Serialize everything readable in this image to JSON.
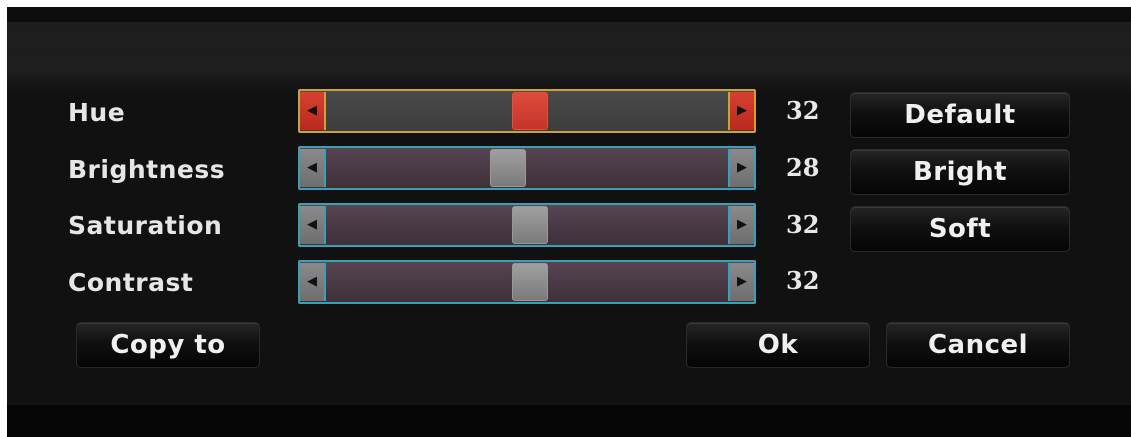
{
  "window": {
    "title": ""
  },
  "rows": [
    {
      "label": "Hue",
      "value": "32",
      "level": 0.5,
      "dec": "◀",
      "inc": "▶"
    },
    {
      "label": "Brightness",
      "value": "28",
      "level": 0.44,
      "dec": "◀",
      "inc": "▶"
    },
    {
      "label": "Saturation",
      "value": "32",
      "level": 0.5,
      "dec": "◀",
      "inc": "▶"
    },
    {
      "label": "Contrast",
      "value": "32",
      "level": 0.5,
      "dec": "◀",
      "inc": "▶"
    }
  ],
  "presets": {
    "default_label": "Default",
    "bright_label": "Bright",
    "soft_label": "Soft"
  },
  "actions": {
    "copy_label": "Copy to",
    "ok_label": "Ok",
    "cancel_label": "Cancel"
  },
  "colors": {
    "active_slider": "#c9352a",
    "slider_border": "#3aa0b8",
    "active_border": "#c9a23a"
  }
}
